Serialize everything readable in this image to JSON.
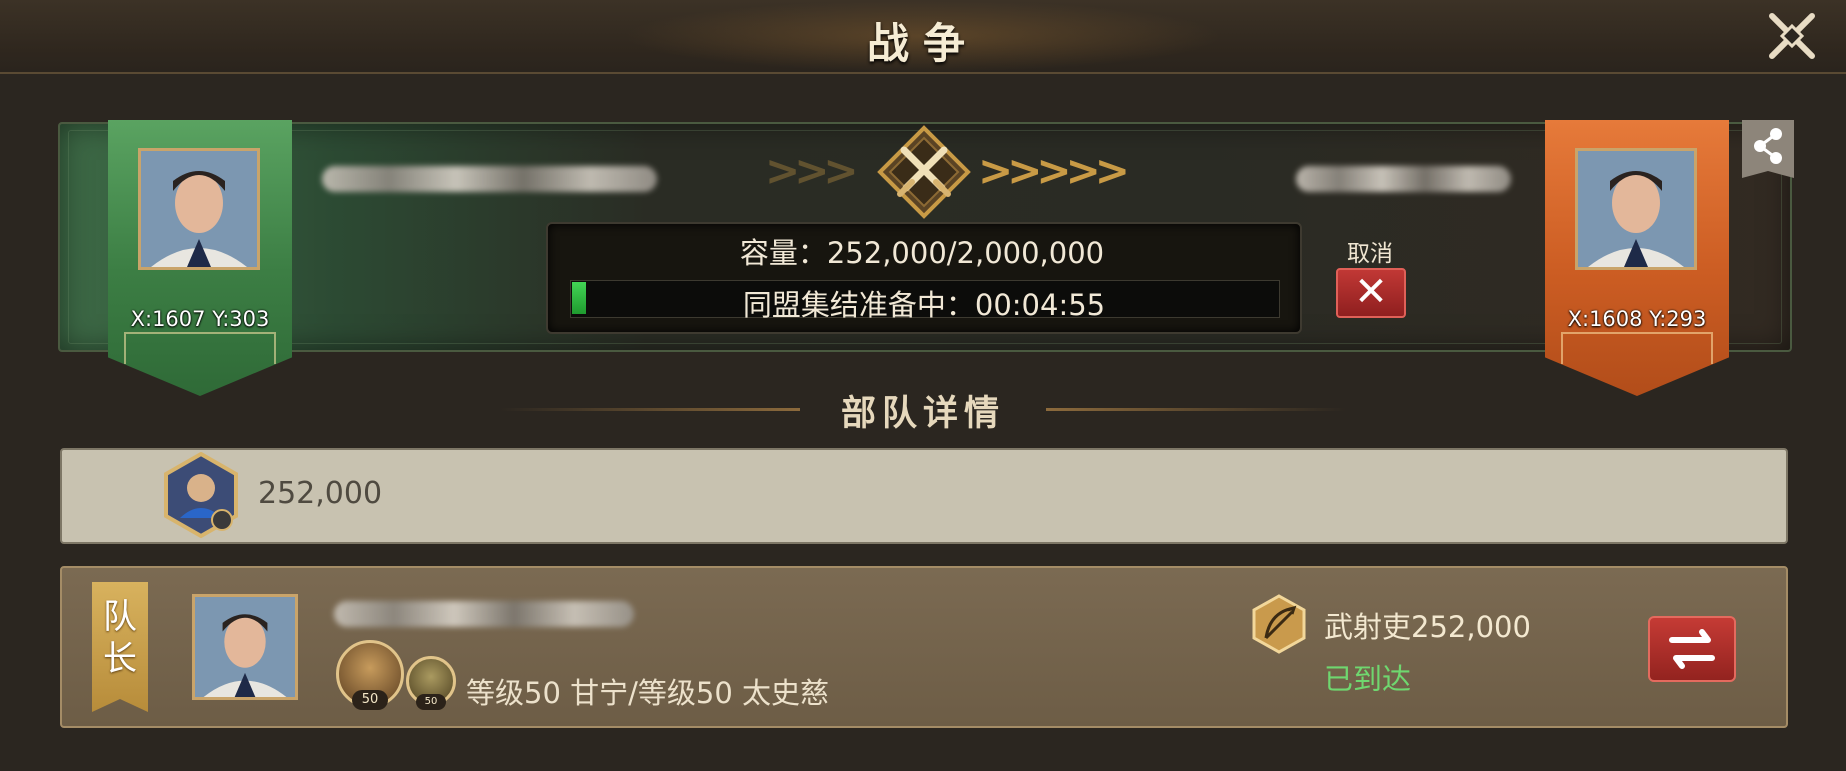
{
  "header": {
    "title": "战争",
    "close_icon": "close-icon"
  },
  "attacker": {
    "coord": "X:1607 Y:303",
    "banner_color": "#3c7e44"
  },
  "defender": {
    "coord": "X:1608 Y:293",
    "banner_color": "#cc5d23"
  },
  "rally": {
    "capacity_text": "容量：252,000/2,000,000",
    "progress_fraction": 0.02,
    "status_text": "同盟集结准备中：00:04:55"
  },
  "cancel": {
    "label": "取消",
    "button_glyph": "✕"
  },
  "section": {
    "title": "部队详情"
  },
  "total": {
    "value": "252,000"
  },
  "leader": {
    "tag": "队长",
    "hero1_level": "50",
    "hero2_level": "50",
    "heroes_text": "等级50 甘宁/等级50 太史慈",
    "troop_text": "武射吏252,000",
    "status": "已到达",
    "status_color": "#6fd76f"
  },
  "colors": {
    "accent_gold": "#c89a45",
    "cancel_red": "#b72d2a"
  }
}
